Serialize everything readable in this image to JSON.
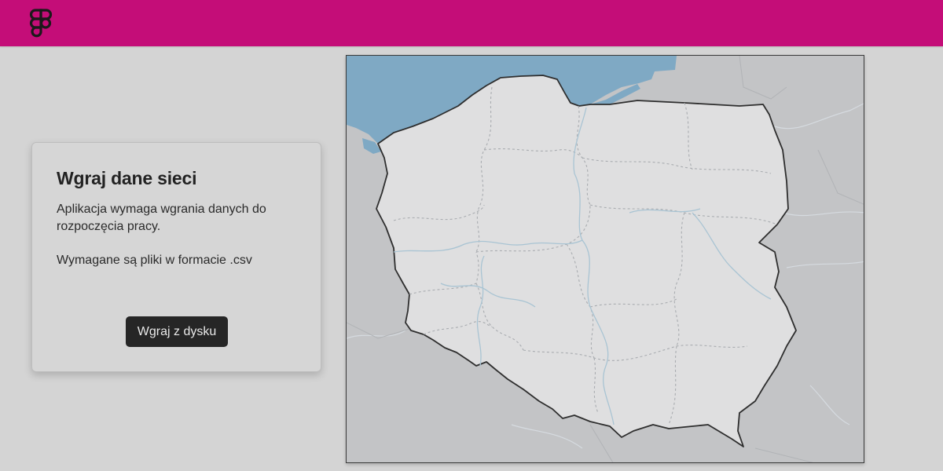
{
  "topbar": {
    "color": "#c40d78",
    "logo_icon": "figma-logo-icon"
  },
  "upload_card": {
    "title": "Wgraj dane sieci",
    "description": "Aplikacja wymaga wgrania danych do rozpoczęcia pracy.",
    "requirement": "Wymagane są pliki w formacie .csv",
    "button_label": "Wgraj z dysku"
  },
  "map": {
    "country": "Poland",
    "sea_color": "#7fa9c4",
    "land_color": "#dfdfe0",
    "neighbor_color": "#c3c4c6",
    "border_color": "#2e2e2e"
  }
}
